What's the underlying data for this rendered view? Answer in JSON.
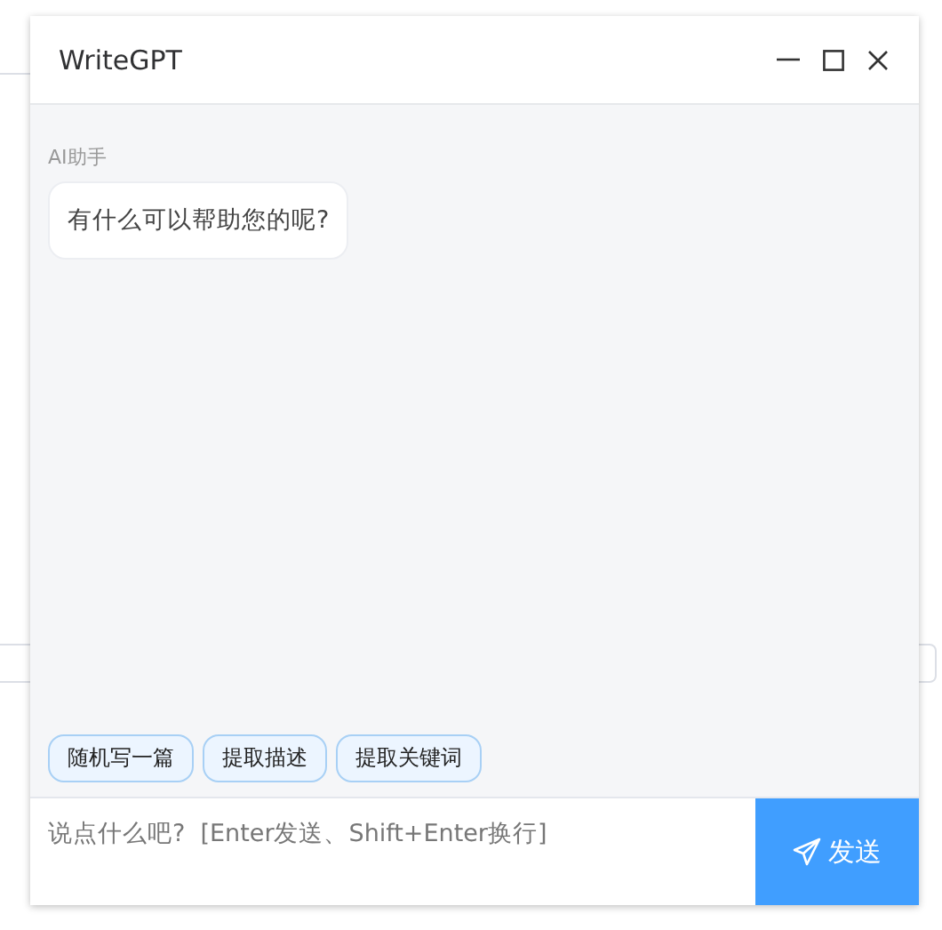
{
  "window": {
    "title": "WriteGPT"
  },
  "messages": [
    {
      "sender": "AI助手",
      "text": "有什么可以帮助您的呢?"
    }
  ],
  "quick_actions": [
    {
      "label": "随机写一篇"
    },
    {
      "label": "提取描述"
    },
    {
      "label": "提取关键词"
    }
  ],
  "input": {
    "placeholder": "说点什么吧?  [Enter发送、Shift+Enter换行]"
  },
  "send_button": {
    "label": "发送"
  }
}
